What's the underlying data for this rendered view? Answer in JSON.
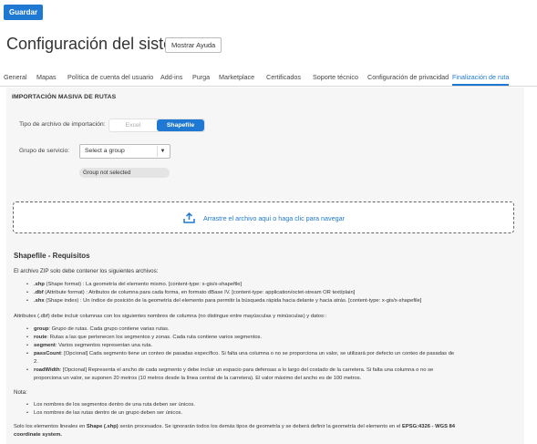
{
  "toolbar": {
    "save_label": "Guardar"
  },
  "header": {
    "title": "Configuración del sistema",
    "help_label": "Mostrar Ayuda"
  },
  "tabs": [
    {
      "label": "General",
      "active": false
    },
    {
      "label": "Mapas",
      "active": false
    },
    {
      "label": "Política de cuenta del usuario",
      "active": false
    },
    {
      "label": "Add-ins",
      "active": false
    },
    {
      "label": "Purga",
      "active": false
    },
    {
      "label": "Marketplace",
      "active": false
    },
    {
      "label": "Certificados",
      "active": false
    },
    {
      "label": "Soporte técnico",
      "active": false
    },
    {
      "label": "Configuración de privacidad",
      "active": false
    },
    {
      "label": "Finalización de ruta",
      "active": true
    }
  ],
  "import": {
    "section_title": "IMPORTACIÓN MASIVA DE RUTAS",
    "file_type_label": "Tipo de archivo de importación:",
    "file_type_options": [
      "Excel",
      "Shapefile"
    ],
    "file_type_selected": "Shapefile",
    "service_group_label": "Grupo de servicio:",
    "service_group_value": "Select a group",
    "service_group_status": "Group not selected",
    "dropzone_text": "Arrastre el archivo aquí o haga clic para navegar"
  },
  "requirements": {
    "title": "Shapefile - Requisitos",
    "intro": "El archivo ZIP solo debe contener los siguientes archivos:",
    "files": [
      {
        "key": ".shp",
        "text": " (Shape format) : La geometría del elemento mismo. [content-type: x-gis/x-shapefile]"
      },
      {
        "key": ".dbf",
        "text": " (Attribute format) : Atributos de columna para cada forma, en formato dBase IV. [content-type: application/octet-stream OR text/plain]"
      },
      {
        "key": ".shx",
        "text": " (Shape index) : Un índice de posición de la geometría del elemento para permitir la búsqueda rápida hacia delante y hacia atrás. [content-type: x-gis/x-shapefile]"
      }
    ],
    "attributes_intro": "Attributes (.dbf) debe incluir columnas con los siguientes nombres de columna (no distingue entre mayúsculas y minúsculas) y datos::",
    "attributes": [
      {
        "key": "group",
        "text": ": Grupo de rutas. Cada grupo contiene varias rutas."
      },
      {
        "key": "route",
        "text": ": Rutas a las que pertenecen los segmentos y zonas. Cada ruta contiene varios segmentos."
      },
      {
        "key": "segment",
        "text": ": Varios segmentos representan una ruta."
      },
      {
        "key": "passCount",
        "text": ": [Opcional] Cada segmento tiene un conteo de pasadas específico. Si falta una columna o no se proporciona un valor, se utilizará por defecto un conteo de pasadas de"
      },
      {
        "key": "",
        "text": "2."
      },
      {
        "key": "roadWidth",
        "text": ": [Opcional] Representa el ancho de cada segmento y debe incluir un espacio para defensas a lo largo del costado de la carretera. Si falta una columna o no se"
      },
      {
        "key": "",
        "text": "proporciona un valor, se suponen 20 metros (10 metros desde la línea central de la carretera). El valor máximo del ancho es de 100 metros."
      }
    ],
    "note_label": "Nota:",
    "notes": [
      "Los nombres de los segmentos dentro de una ruta deben ser únicos.",
      "Los nombres de las rutas dentro de un grupo deben ser únicos."
    ],
    "footer_a": "Solo los elementos lineales en ",
    "footer_b": "Shape (.shp)",
    "footer_c": " serán procesados. Se ignorarán todos los demás tipos de geometría y se deberá definir la geometría del elemento en el ",
    "footer_d": "EPSG:4326 - WGS 84",
    "footer_e": "coordinate system."
  },
  "colors": {
    "accent": "#1f78d1",
    "panel_bg": "#f6f6f6"
  },
  "icons": {
    "dropzone": "upload-icon",
    "select": "chevron-down-icon"
  }
}
